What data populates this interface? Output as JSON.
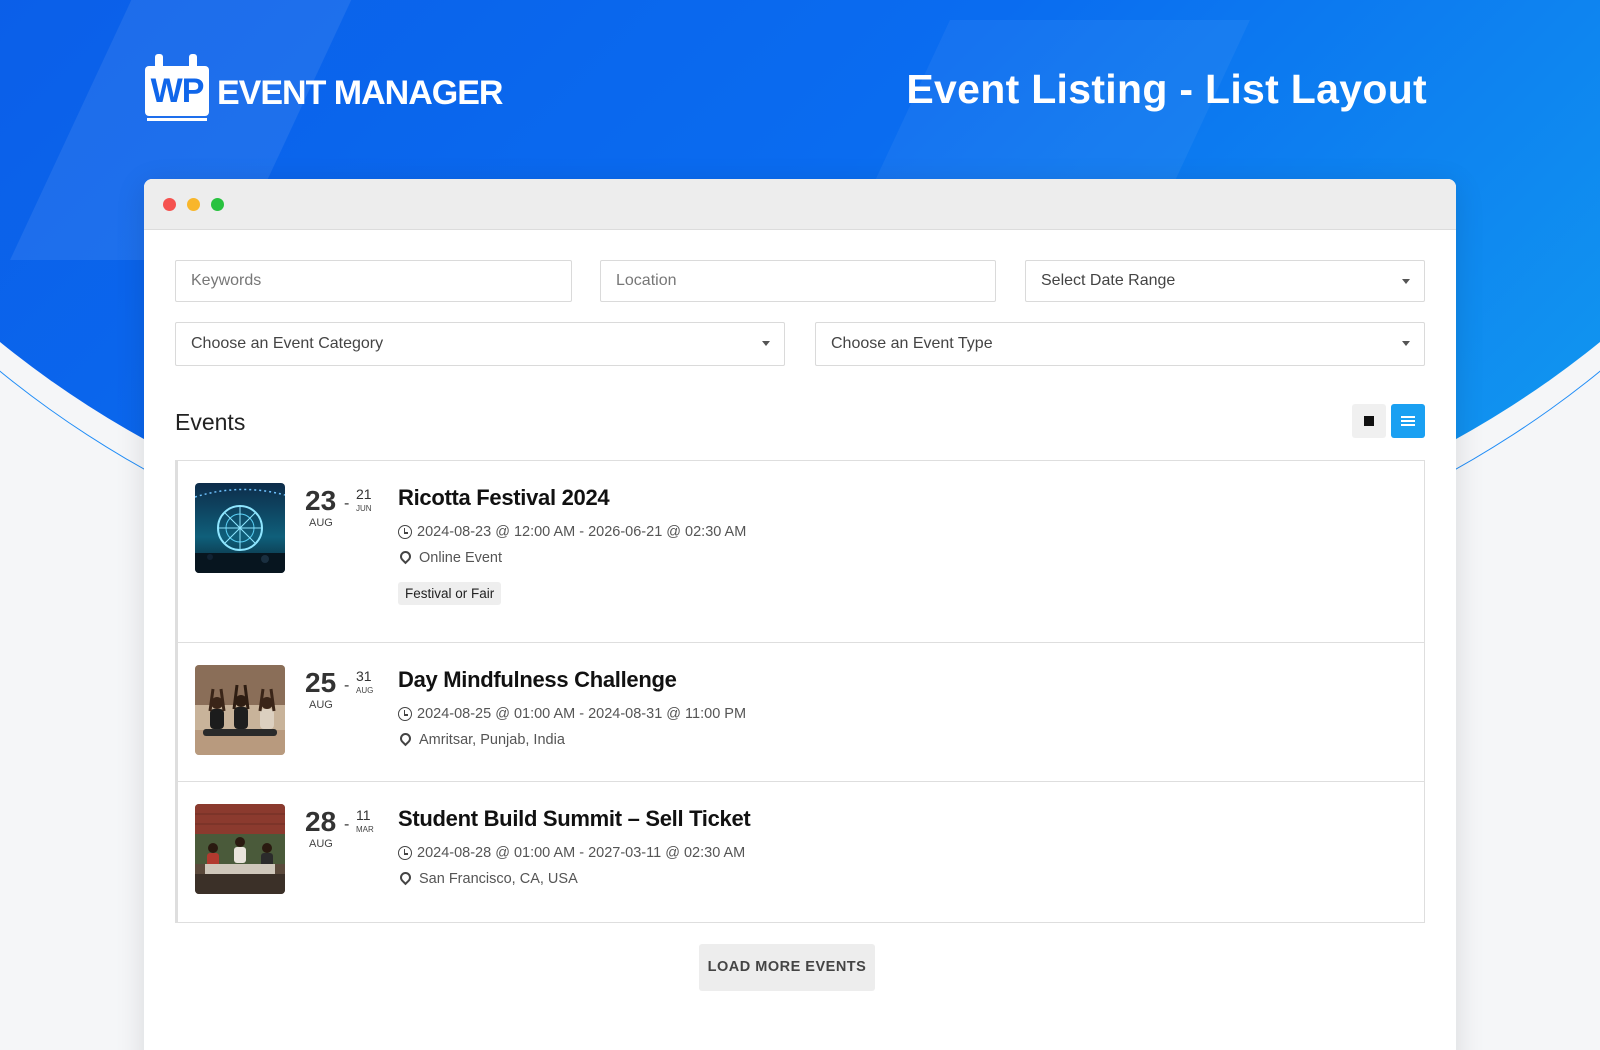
{
  "brand": {
    "logo_mark": "WP",
    "logo_text": "EVENT MANAGER"
  },
  "page_title": "Event Listing - List Layout",
  "filters": {
    "keywords_placeholder": "Keywords",
    "location_placeholder": "Location",
    "date_range": "Select Date Range",
    "category": "Choose an Event Category",
    "event_type": "Choose an Event Type"
  },
  "events_heading": "Events",
  "events": [
    {
      "title": "Ricotta Festival 2024",
      "start_day": "23",
      "start_month": "AUG",
      "end_day": "21",
      "end_month": "JUN",
      "datetime": "2024-08-23 @ 12:00 AM - 2026-06-21 @ 02:30 AM",
      "location": "Online Event",
      "tag": "Festival or Fair"
    },
    {
      "title": "Day Mindfulness Challenge",
      "start_day": "25",
      "start_month": "AUG",
      "end_day": "31",
      "end_month": "AUG",
      "datetime": "2024-08-25 @ 01:00 AM - 2024-08-31 @ 11:00 PM",
      "location": "Amritsar, Punjab, India"
    },
    {
      "title": "Student Build Summit – Sell Ticket",
      "start_day": "28",
      "start_month": "AUG",
      "end_day": "11",
      "end_month": "MAR",
      "datetime": "2024-08-28 @ 01:00 AM - 2027-03-11 @ 02:30 AM",
      "location": "San Francisco, CA, USA"
    }
  ],
  "load_more_label": "LOAD MORE EVENTS",
  "colors": {
    "accent": "#1aa0f2",
    "hero_blue": "#0b5ee8"
  }
}
